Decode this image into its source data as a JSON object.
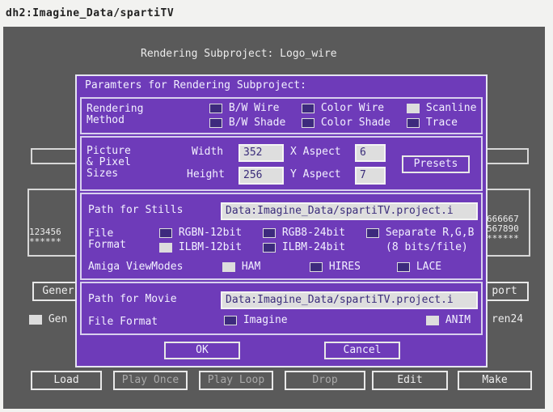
{
  "window": {
    "title": "dh2:Imagine_Data/spartiTV"
  },
  "subproject": {
    "heading": "Rendering Subproject: Logo_wire"
  },
  "background": {
    "left_digits": [
      "123456",
      "******"
    ],
    "right_digits": [
      "666667",
      "567890",
      "******"
    ],
    "gen_button": "Gener",
    "gen_check": "Gen",
    "port_button": "port",
    "right_label": "ren24"
  },
  "dialog": {
    "title": "Paramters for Rendering Subproject:",
    "rendering_method": {
      "label": [
        "Rendering",
        "Method"
      ],
      "options": [
        {
          "label": "B/W Wire",
          "checked": false
        },
        {
          "label": "Color Wire",
          "checked": false
        },
        {
          "label": "Scanline",
          "checked": true
        },
        {
          "label": "B/W Shade",
          "checked": false
        },
        {
          "label": "Color Shade",
          "checked": false
        },
        {
          "label": "Trace",
          "checked": false
        }
      ]
    },
    "picture": {
      "label": [
        "Picture",
        "& Pixel",
        "Sizes"
      ],
      "width_label": "Width",
      "width_value": "352",
      "height_label": "Height",
      "height_value": "256",
      "xaspect_label": "X Aspect",
      "xaspect_value": "6",
      "yaspect_label": "Y Aspect",
      "yaspect_value": "7",
      "presets_button": "Presets"
    },
    "stills": {
      "path_label": "Path for Stills",
      "path_value": "Data:Imagine_Data/spartiTV.project.i",
      "file_format_label": [
        "File",
        "Format"
      ],
      "formats": [
        {
          "label": "RGBN-12bit",
          "checked": false
        },
        {
          "label": "RGB8-24bit",
          "checked": false
        },
        {
          "label": "Separate R,G,B",
          "checked": false
        },
        {
          "label": "ILBM-12bit",
          "checked": true
        },
        {
          "label": "ILBM-24bit",
          "checked": false
        }
      ],
      "separate_note": "(8 bits/file)",
      "viewmodes_label": "Amiga ViewModes",
      "viewmodes": [
        {
          "label": "HAM",
          "checked": true
        },
        {
          "label": "HIRES",
          "checked": false
        },
        {
          "label": "LACE",
          "checked": false
        }
      ]
    },
    "movie": {
      "path_label": "Path for Movie",
      "path_value": "Data:Imagine_Data/spartiTV.project.i",
      "file_format_label": "File Format",
      "imagine": {
        "label": "Imagine",
        "checked": false
      },
      "anim": {
        "label": "ANIM",
        "checked": true
      }
    },
    "ok_button": "OK",
    "cancel_button": "Cancel"
  },
  "bottom_bar": {
    "load": "Load",
    "play_once": "Play Once",
    "play_loop": "Play Loop",
    "drop": "Drop",
    "edit": "Edit",
    "make": "Make"
  }
}
